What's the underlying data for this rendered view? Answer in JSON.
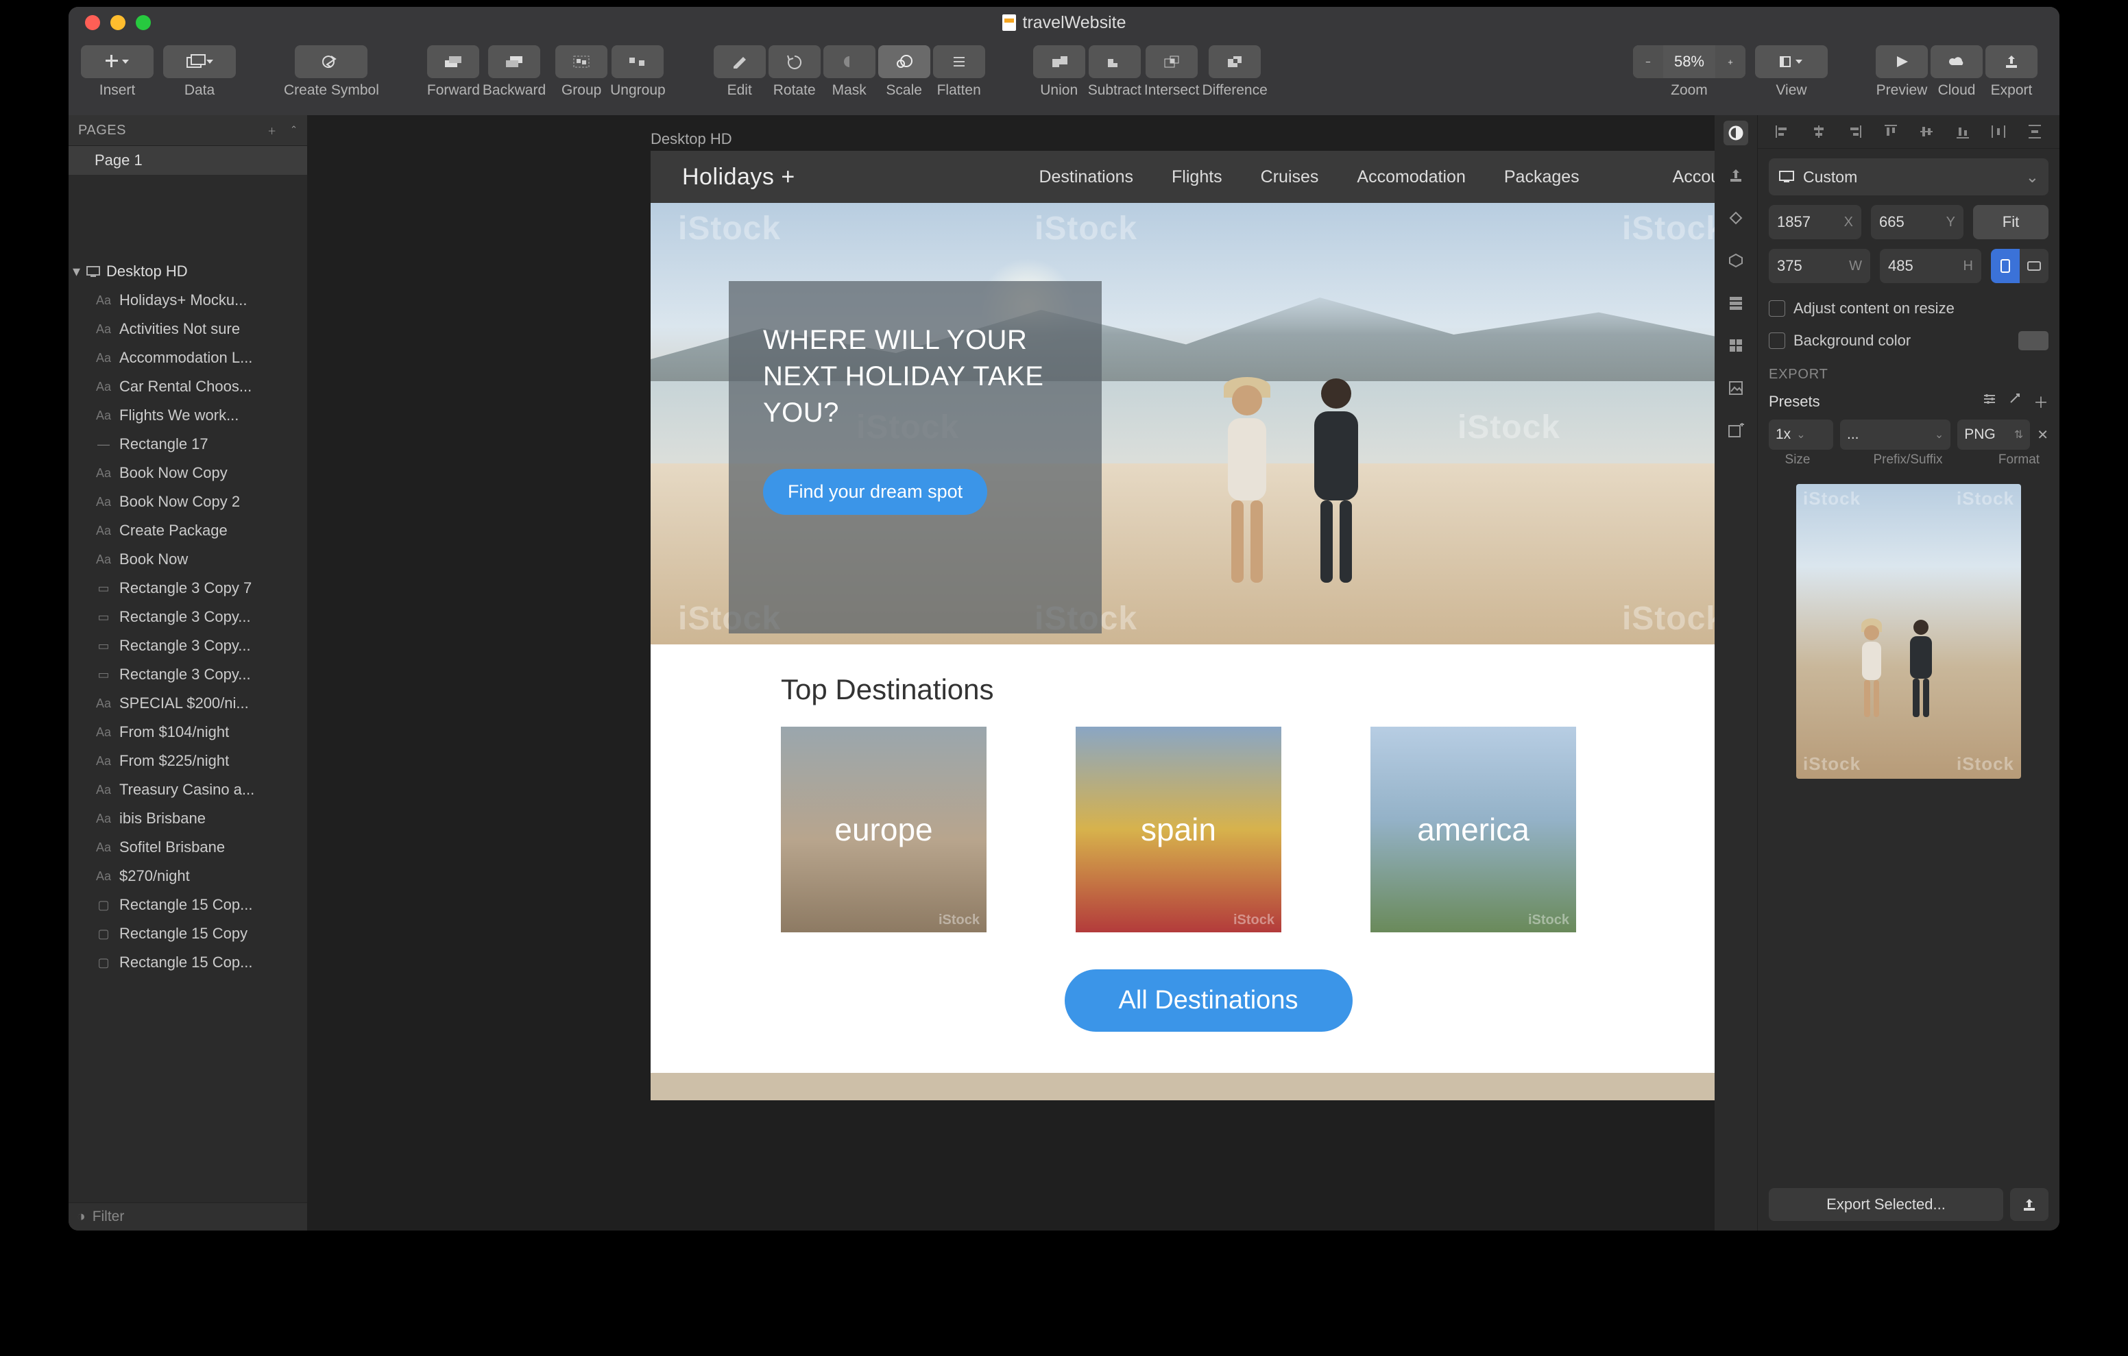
{
  "window": {
    "title": "travelWebsite"
  },
  "toolbar": {
    "insert": "Insert",
    "data": "Data",
    "createSymbol": "Create Symbol",
    "forward": "Forward",
    "backward": "Backward",
    "group": "Group",
    "ungroup": "Ungroup",
    "edit": "Edit",
    "rotate": "Rotate",
    "mask": "Mask",
    "scale": "Scale",
    "flatten": "Flatten",
    "union": "Union",
    "subtract": "Subtract",
    "intersect": "Intersect",
    "difference": "Difference",
    "zoom": "Zoom",
    "zoomValue": "58%",
    "view": "View",
    "preview": "Preview",
    "cloud": "Cloud",
    "export": "Export"
  },
  "pages": {
    "header": "PAGES",
    "items": [
      "Page 1"
    ]
  },
  "artboard": {
    "name": "Desktop HD"
  },
  "layers": [
    {
      "icon": "Aa",
      "label": "Holidays+ Mocku..."
    },
    {
      "icon": "Aa",
      "label": "Activities Not sure"
    },
    {
      "icon": "Aa",
      "label": "Accommodation L..."
    },
    {
      "icon": "Aa",
      "label": "Car Rental Choos..."
    },
    {
      "icon": "Aa",
      "label": "Flights We work..."
    },
    {
      "icon": "—",
      "label": "Rectangle 17"
    },
    {
      "icon": "Aa",
      "label": "Book Now Copy"
    },
    {
      "icon": "Aa",
      "label": "Book Now Copy 2"
    },
    {
      "icon": "Aa",
      "label": "Create Package"
    },
    {
      "icon": "Aa",
      "label": "Book Now"
    },
    {
      "icon": "▭",
      "label": "Rectangle 3 Copy 7"
    },
    {
      "icon": "▭",
      "label": "Rectangle 3 Copy..."
    },
    {
      "icon": "▭",
      "label": "Rectangle 3 Copy..."
    },
    {
      "icon": "▭",
      "label": "Rectangle 3 Copy..."
    },
    {
      "icon": "Aa",
      "label": "SPECIAL $200/ni..."
    },
    {
      "icon": "Aa",
      "label": "From $104/night"
    },
    {
      "icon": "Aa",
      "label": "From $225/night"
    },
    {
      "icon": "Aa",
      "label": "Treasury Casino a..."
    },
    {
      "icon": "Aa",
      "label": "ibis Brisbane"
    },
    {
      "icon": "Aa",
      "label": "Sofitel Brisbane"
    },
    {
      "icon": "Aa",
      "label": "$270/night"
    },
    {
      "icon": "▢",
      "label": "Rectangle 15 Cop..."
    },
    {
      "icon": "▢",
      "label": "Rectangle 15 Copy"
    },
    {
      "icon": "▢",
      "label": "Rectangle 15 Cop..."
    }
  ],
  "filter": {
    "placeholder": "Filter"
  },
  "site": {
    "logo": "Holidays +",
    "nav": [
      "Destinations",
      "Flights",
      "Cruises",
      "Accomodation",
      "Packages",
      "Account"
    ],
    "heroHeadline": "WHERE WILL YOUR NEXT HOLIDAY TAKE YOU?",
    "heroCta": "Find your dream spot",
    "topDestTitle": "Top Destinations",
    "cards": [
      "europe",
      "spain",
      "america"
    ],
    "allDest": "All Destinations",
    "watermark": "iStock"
  },
  "inspector": {
    "resizeLabel": "Custom",
    "x": "1857",
    "xUnit": "X",
    "y": "665",
    "yUnit": "Y",
    "w": "375",
    "wUnit": "W",
    "h": "485",
    "hUnit": "H",
    "fit": "Fit",
    "adjustContent": "Adjust content on resize",
    "bgColor": "Background color",
    "exportHeader": "EXPORT",
    "presets": "Presets",
    "size": "1x",
    "prefix": "...",
    "format": "PNG",
    "sizeLabel": "Size",
    "prefixLabel": "Prefix/Suffix",
    "formatLabel": "Format",
    "exportSelected": "Export Selected..."
  }
}
